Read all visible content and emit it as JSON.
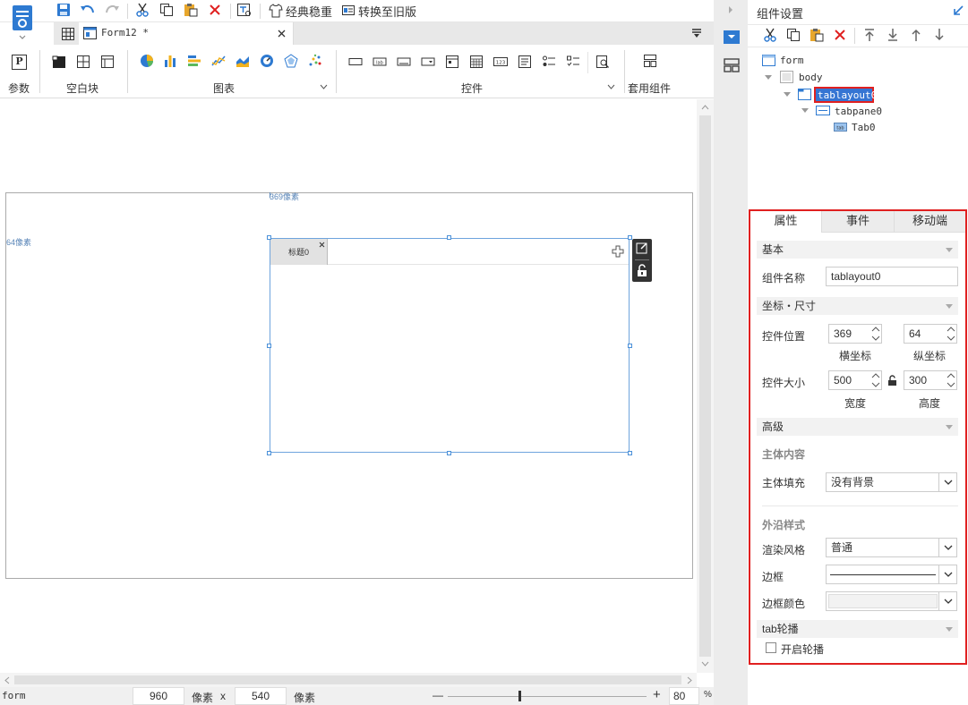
{
  "toolbar": {
    "classic_label": "经典稳重",
    "convert_label": "转换至旧版"
  },
  "tabs": {
    "file_tab": "Form12 *"
  },
  "ribbon": {
    "param_label": "参数",
    "blank_label": "空白块",
    "chart_label": "图表",
    "control_label": "控件",
    "template_label": "套用组件"
  },
  "canvas": {
    "x_marker": "369像素",
    "y_marker": "64像素",
    "tab_title": "标题0"
  },
  "statusbar": {
    "form_label": "form",
    "width_value": "960",
    "unit1": "像素",
    "times": "x",
    "height_value": "540",
    "unit2": "像素",
    "minus": "—",
    "plus": "+",
    "zoom_value": "80",
    "percent": "%"
  },
  "panel": {
    "title": "组件设置",
    "tree": {
      "form": "form",
      "body": "body",
      "tablayout": "tablayout0",
      "tabpane": "tabpane0",
      "tab": "Tab0"
    },
    "prop_tabs": [
      "属性",
      "事件",
      "移动端"
    ],
    "sections": {
      "basic": "基本",
      "coords": "坐标・尺寸",
      "advanced": "高级",
      "tab_carousel": "tab轮播"
    },
    "fields": {
      "name_label": "组件名称",
      "name_value": "tablayout0",
      "pos_label": "控件位置",
      "x_value": "369",
      "y_value": "64",
      "x_caption": "横坐标",
      "y_caption": "纵坐标",
      "size_label": "控件大小",
      "w_value": "500",
      "h_value": "300",
      "w_caption": "宽度",
      "h_caption": "高度",
      "body_content": "主体内容",
      "body_fill_label": "主体填充",
      "body_fill_value": "没有背景",
      "edge_style": "外沿样式",
      "render_label": "渲染风格",
      "render_value": "普通",
      "border_label": "边框",
      "border_color_label": "边框颜色",
      "carousel_label": "开启轮播"
    }
  },
  "colors": {
    "accent": "#2e7ad1",
    "highlight_red": "#e02020",
    "select_blue": "#3575d3"
  }
}
